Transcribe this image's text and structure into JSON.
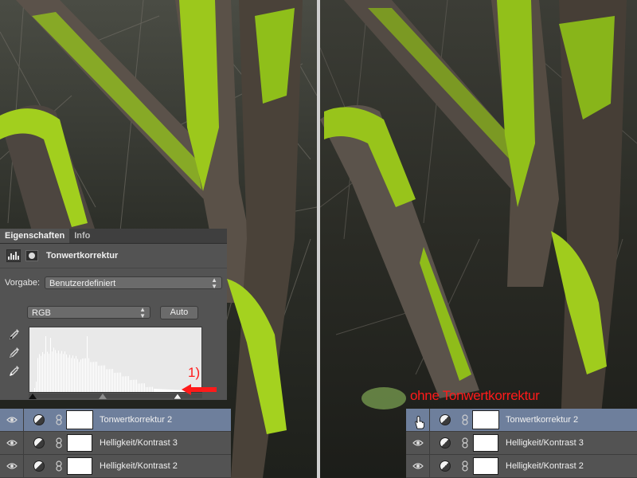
{
  "properties_panel": {
    "tabs": [
      {
        "label": "Eigenschaften",
        "active": true
      },
      {
        "label": "Info",
        "active": false
      }
    ],
    "title": "Tonwertkorrektur",
    "preset_label": "Vorgabe:",
    "preset_value": "Benutzerdefiniert",
    "channel_value": "RGB",
    "auto_button": "Auto",
    "eyedroppers": [
      "black-point-eyedropper-icon",
      "gray-point-eyedropper-icon",
      "white-point-eyedropper-icon"
    ]
  },
  "annotations": {
    "step_number": "1)",
    "caption": "ohne Tonwertkorrektur",
    "color": "#ff1a1a"
  },
  "layers_left": [
    {
      "name": "Tonwertkorrektur 2",
      "selected": true
    },
    {
      "name": "Helligkeit/Kontrast 3",
      "selected": false
    },
    {
      "name": "Helligkeit/Kontrast 2",
      "selected": false
    }
  ],
  "layers_right": [
    {
      "name": "Tonwertkorrektur 2",
      "selected": true,
      "visible": false
    },
    {
      "name": "Helligkeit/Kontrast 3",
      "selected": false
    },
    {
      "name": "Helligkeit/Kontrast 2",
      "selected": false
    }
  ],
  "colors": {
    "panel_bg": "#535353",
    "selected_row": "#6e7f9c",
    "moss": "#9bc41a"
  }
}
